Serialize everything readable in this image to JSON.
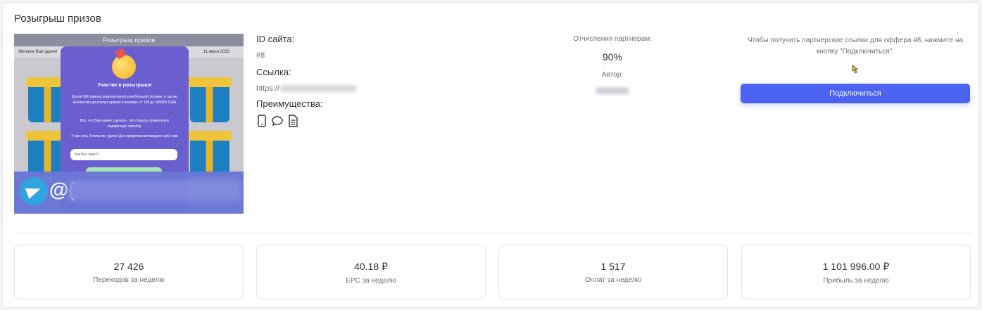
{
  "card": {
    "title": "Розыгрыш призов"
  },
  "preview": {
    "header": "Розыгрыш призов",
    "left_text": "Желаем Вам удачи!",
    "right_text": "11 июня 2023",
    "modal_title": "Участие в розыгрыше",
    "modal_text": "Более 500 единиц компьютерной и мобильной техники, а так же множество денежных призов в размере от 105 до 100000 США",
    "modal_text2": "Все, что Вам нужно сделать - это открыть правильную подарочную коробку.",
    "modal_text3": "У вас есть 3 попытки, удачи! Для продолжения введите своё имя",
    "input_placeholder": "Как Вас зовут?",
    "telegram_at": "@("
  },
  "info": {
    "site_id_label": "ID сайта:",
    "site_id_value": "#8",
    "link_label": "Ссылка:",
    "link_prefix": "https://",
    "advantages_label": "Преимущества:",
    "advantage_icons": [
      "mobile-icon",
      "chat-icon",
      "document-icon"
    ]
  },
  "commission": {
    "label": "Отчисления партнерам:",
    "value": "90%",
    "author_label": "Автор:"
  },
  "connect": {
    "hint": "Чтобы получить партнерские ссылки для оффера #8, нажмите на кнопку \"Подключиться\".",
    "button_label": "Подключиться"
  },
  "stats": [
    {
      "value": "27 426",
      "caption": "Переходов за неделю"
    },
    {
      "value": "40.18 ₽",
      "caption": "EPC за неделю"
    },
    {
      "value": "1 517",
      "caption": "Оплат за неделю"
    },
    {
      "value": "1 101 996.00 ₽",
      "caption": "Прибыль за неделю"
    }
  ],
  "colors": {
    "accent": "#4b63f0",
    "modal": "#6b5fd0",
    "telegram": "#2aa3e0"
  }
}
